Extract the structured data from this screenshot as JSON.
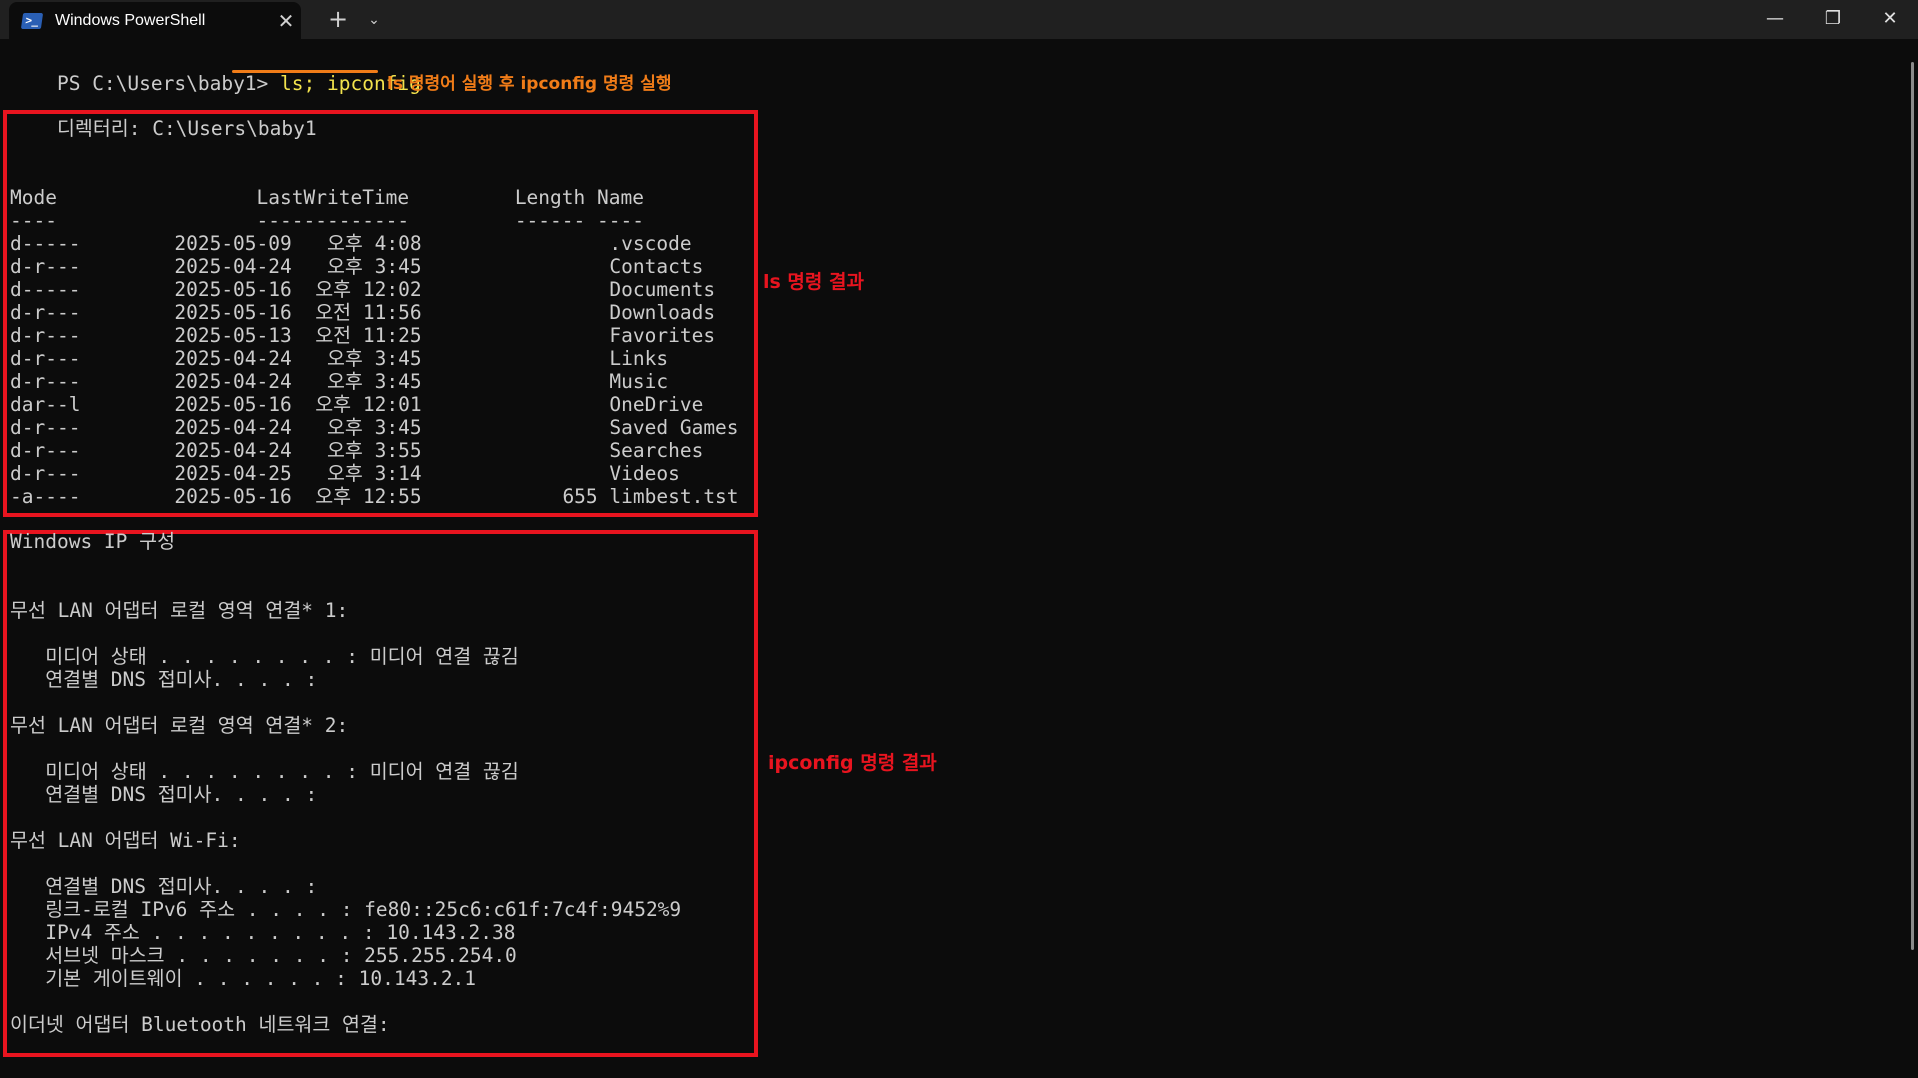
{
  "window": {
    "tab_title": "Windows PowerShell",
    "tab_close": "✕",
    "new_tab": "+",
    "dropdown": "⌄",
    "minimize": "—",
    "maximize": "❐",
    "close": "✕"
  },
  "prompt": {
    "prefix": "PS C:\\Users\\baby1> ",
    "command": "ls; ipconfig"
  },
  "ls_output": {
    "directory": "    디렉터리: C:\\Users\\baby1",
    "header": "Mode                 LastWriteTime         Length Name",
    "separator": "----                 -------------         ------ ----",
    "rows": [
      "d-----        2025-05-09   오후 4:08                .vscode",
      "d-r---        2025-04-24   오후 3:45                Contacts",
      "d-----        2025-05-16  오후 12:02                Documents",
      "d-r---        2025-05-16  오전 11:56                Downloads",
      "d-r---        2025-05-13  오전 11:25                Favorites",
      "d-r---        2025-04-24   오후 3:45                Links",
      "d-r---        2025-04-24   오후 3:45                Music",
      "dar--l        2025-05-16  오후 12:01                OneDrive",
      "d-r---        2025-04-24   오후 3:45                Saved Games",
      "d-r---        2025-04-24   오후 3:55                Searches",
      "d-r---        2025-04-25   오후 3:14                Videos",
      "-a----        2025-05-16  오후 12:55            655 limbest.tst"
    ]
  },
  "ipconfig_output": {
    "title": "Windows IP 구성",
    "lines": [
      {
        "row": 3,
        "text": "무선 LAN 어댑터 로컬 영역 연결* 1:"
      },
      {
        "row": 5,
        "text": "   미디어 상태 . . . . . . . . : 미디어 연결 끊김"
      },
      {
        "row": 6,
        "text": "   연결별 DNS 접미사. . . . :"
      },
      {
        "row": 8,
        "text": "무선 LAN 어댑터 로컬 영역 연결* 2:"
      },
      {
        "row": 10,
        "text": "   미디어 상태 . . . . . . . . : 미디어 연결 끊김"
      },
      {
        "row": 11,
        "text": "   연결별 DNS 접미사. . . . :"
      },
      {
        "row": 13,
        "text": "무선 LAN 어댑터 Wi-Fi:"
      },
      {
        "row": 15,
        "text": "   연결별 DNS 접미사. . . . :"
      },
      {
        "row": 16,
        "text": "   링크-로컬 IPv6 주소 . . . . : fe80::25c6:c61f:7c4f:9452%9"
      },
      {
        "row": 17,
        "text": "   IPv4 주소 . . . . . . . . . : 10.143.2.38"
      },
      {
        "row": 18,
        "text": "   서브넷 마스크 . . . . . . . : 255.255.254.0"
      },
      {
        "row": 19,
        "text": "   기본 게이트웨이 . . . . . . : 10.143.2.1"
      },
      {
        "row": 21,
        "text": "이더넷 어댑터 Bluetooth 네트워크 연결:"
      }
    ]
  },
  "annotations": {
    "command_note": "ls 명령어 실행 후 ipconfig 명령 실행",
    "ls_note": "ls 명령 결과",
    "ipconfig_note": "ipconfig 명령 결과",
    "command_color": "#f07c18",
    "box_color": "#e8141f"
  }
}
